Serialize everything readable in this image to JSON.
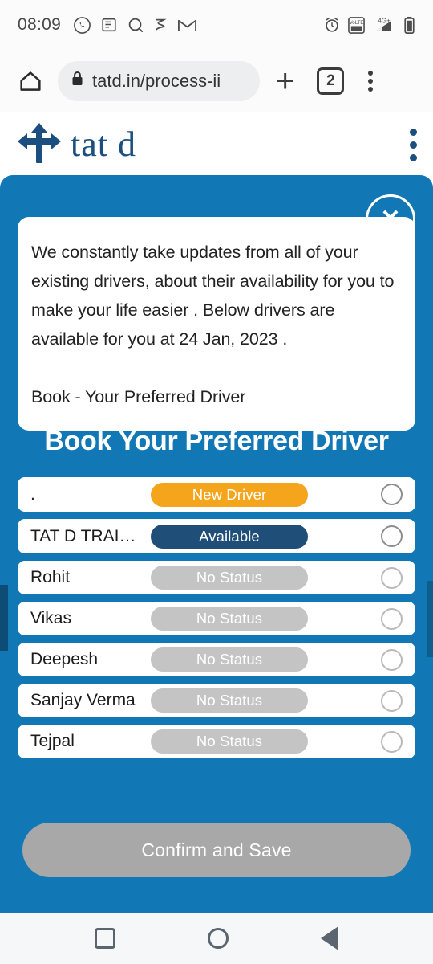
{
  "status_bar": {
    "time": "08:09",
    "left_icons": [
      "whatsapp-icon",
      "news-icon",
      "search-icon",
      "app-icon",
      "gmail-icon"
    ],
    "right_icons": [
      "alarm-icon",
      "volte-icon",
      "signal-4g-plus-icon",
      "battery-icon"
    ],
    "network_label": "4G+",
    "volte_label": "VoLTE"
  },
  "browser_bar": {
    "home_icon": "home-icon",
    "lock_icon": "lock-icon",
    "url": "tatd.in/process-ii",
    "new_tab_label": "+",
    "tab_count": "2",
    "menu_icon": "kebab-menu-icon"
  },
  "site_header": {
    "logo_icon": "directional-arrows-logo",
    "brand": "tat d",
    "menu_icon": "kebab-menu-icon"
  },
  "modal": {
    "close_label": "✕",
    "info_paragraph_1": "We constantly take updates from all of your existing drivers, about their availability for you to make your life easier . Below drivers are available for you at 24 Jan, 2023 .",
    "info_paragraph_2": "Book - Your Preferred Driver",
    "title": "Book Your Preferred Driver",
    "drivers": [
      {
        "name": ".",
        "status": "New Driver",
        "status_type": "new",
        "selected": false
      },
      {
        "name": "TAT D TRAI…",
        "status": "Available",
        "status_type": "available",
        "selected": false
      },
      {
        "name": "Rohit",
        "status": "No Status",
        "status_type": "none",
        "selected": false
      },
      {
        "name": "Vikas",
        "status": "No Status",
        "status_type": "none",
        "selected": false
      },
      {
        "name": "Deepesh",
        "status": "No Status",
        "status_type": "none",
        "selected": false
      },
      {
        "name": "Sanjay Verma",
        "status": "No Status",
        "status_type": "none",
        "selected": false
      },
      {
        "name": "Tejpal",
        "status": "No Status",
        "status_type": "none",
        "selected": false
      }
    ],
    "confirm_label": "Confirm and Save"
  },
  "nav_bar": {
    "recents": "recents-button",
    "home": "home-button",
    "back": "back-button"
  },
  "colors": {
    "modal_blue": "#1178b5",
    "badge_new": "#f5a51b",
    "badge_available": "#1f4e79",
    "badge_none": "#c4c4c4",
    "confirm_disabled": "#a8a8a8",
    "brand_blue": "#1c4f80"
  }
}
